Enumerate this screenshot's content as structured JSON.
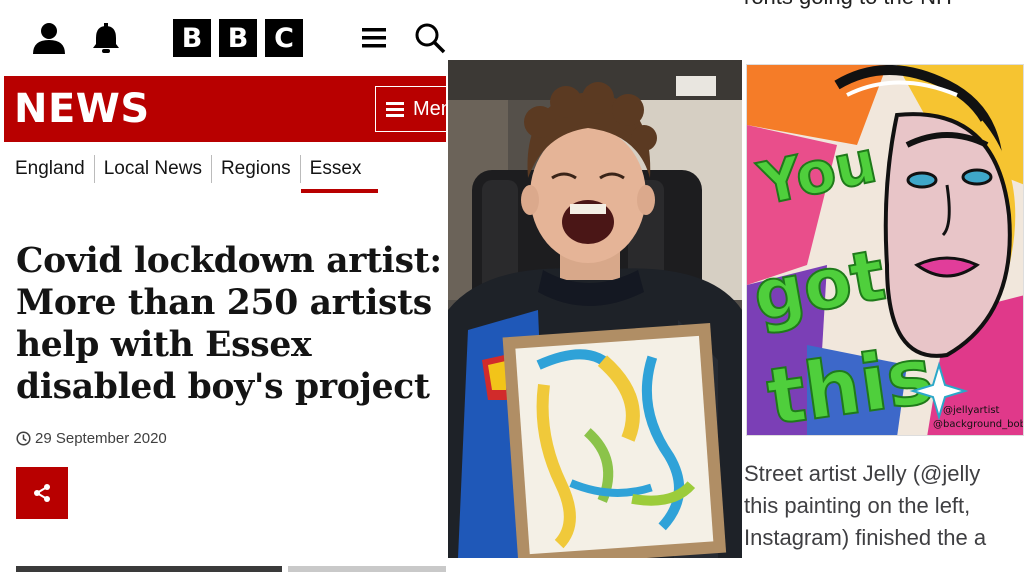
{
  "header": {
    "logo_letters": [
      "B",
      "B",
      "C"
    ],
    "icons": [
      "user-icon",
      "bell-icon",
      "menu-icon",
      "search-icon"
    ]
  },
  "news_bar": {
    "title": "NEWS",
    "menu_label": "Menu",
    "color": "#b80000"
  },
  "breadcrumbs": [
    {
      "label": "England"
    },
    {
      "label": "Local News"
    },
    {
      "label": "Regions"
    },
    {
      "label": "Essex",
      "active": true
    }
  ],
  "article": {
    "headline_lines": [
      "Covid lockdown artist:",
      "More than 250 artists",
      "help with Essex",
      "disabled boy's project"
    ],
    "date": "29 September 2020"
  },
  "right_panel": {
    "top_text": "ronts going to the NH",
    "caption_lines": [
      "Street artist Jelly (@jelly",
      "this painting on the left,",
      "Instagram) finished the a"
    ],
    "artwork_text": "You got this",
    "artwork_signature": "@jellyartist @background_bob"
  }
}
